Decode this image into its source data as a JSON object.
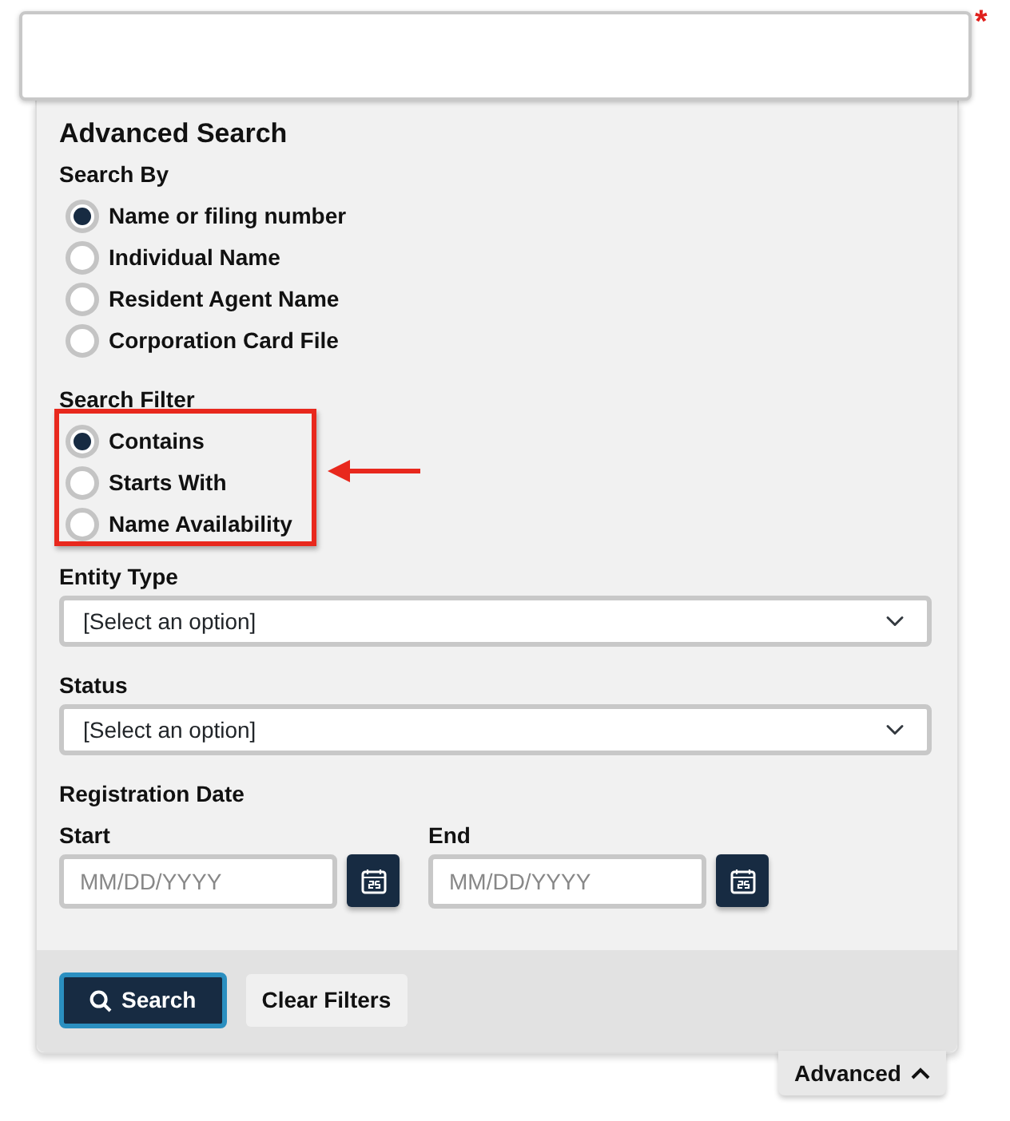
{
  "main_field": {
    "required_mark": "*"
  },
  "panel": {
    "title": "Advanced Search",
    "search_by": {
      "label": "Search By",
      "options": [
        {
          "label": "Name or filing number",
          "selected": true
        },
        {
          "label": "Individual Name",
          "selected": false
        },
        {
          "label": "Resident Agent Name",
          "selected": false
        },
        {
          "label": "Corporation Card File",
          "selected": false
        }
      ]
    },
    "search_filter": {
      "label": "Search Filter",
      "highlighted": true,
      "options": [
        {
          "label": "Contains",
          "selected": true
        },
        {
          "label": "Starts With",
          "selected": false
        },
        {
          "label": "Name Availability",
          "selected": false
        }
      ]
    },
    "entity_type": {
      "label": "Entity Type",
      "value": "[Select an option]"
    },
    "status": {
      "label": "Status",
      "value": "[Select an option]"
    },
    "registration_date": {
      "label": "Registration Date",
      "start": {
        "label": "Start",
        "placeholder": "MM/DD/YYYY"
      },
      "end": {
        "label": "End",
        "placeholder": "MM/DD/YYYY"
      }
    },
    "buttons": [
      {
        "label": "Search",
        "kind": "primary"
      },
      {
        "label": "Clear Filters",
        "kind": "secondary"
      }
    ]
  },
  "toggle": {
    "label": "Advanced",
    "expanded": true
  }
}
